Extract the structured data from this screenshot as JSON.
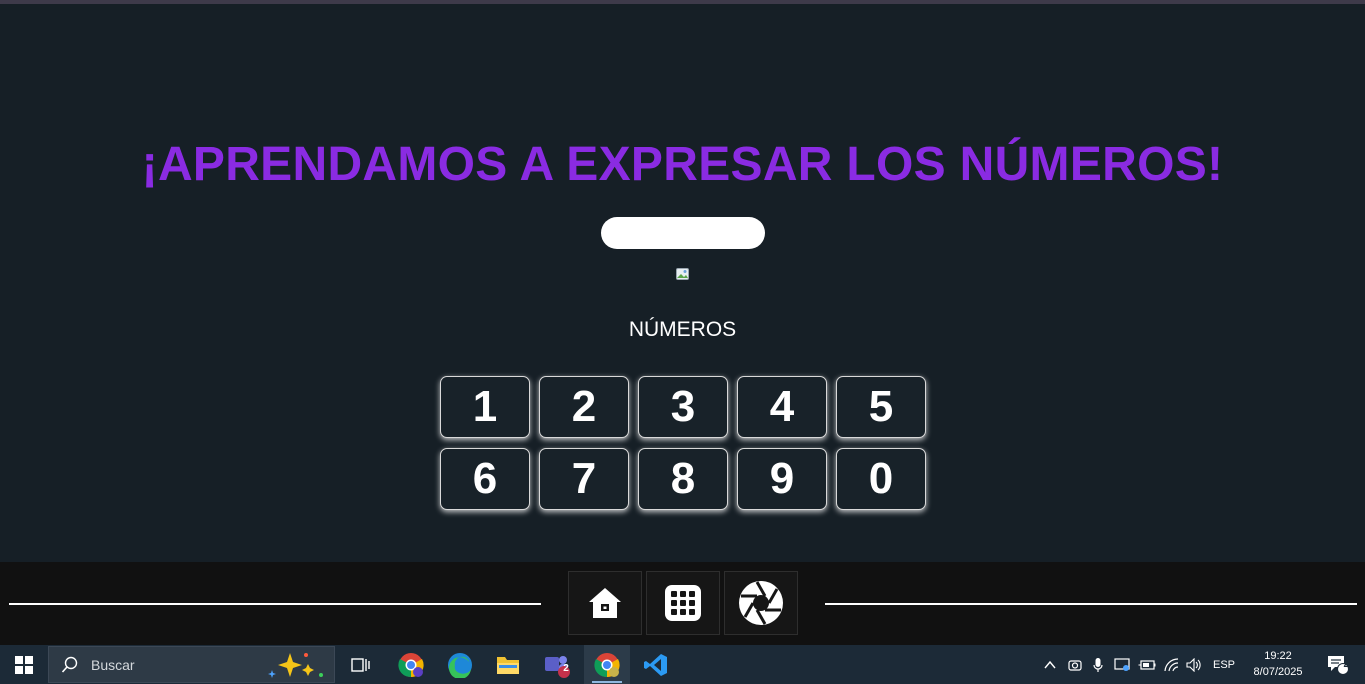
{
  "page": {
    "title": "¡APRENDAMOS A EXPRESAR LOS NÚMEROS!",
    "input_value": "",
    "section_label": "NÚMEROS",
    "numbers_row1": [
      "1",
      "2",
      "3",
      "4",
      "5"
    ],
    "numbers_row2": [
      "6",
      "7",
      "8",
      "9",
      "0"
    ]
  },
  "colors": {
    "background": "#161f26",
    "title": "#8a2be2",
    "footer": "#111111",
    "taskbar": "#1c2a37"
  },
  "footer": {
    "buttons": [
      "home-icon",
      "grid-icon",
      "camera-shutter-icon"
    ]
  },
  "taskbar": {
    "search_placeholder": "Buscar",
    "apps": [
      "chrome-icon",
      "edge-icon",
      "file-explorer-icon",
      "teams-icon",
      "chrome-icon",
      "vscode-icon"
    ],
    "teams_badge": "2",
    "language": "ESP",
    "time": "19:22",
    "date": "8/07/2025",
    "notification_count": "2"
  }
}
